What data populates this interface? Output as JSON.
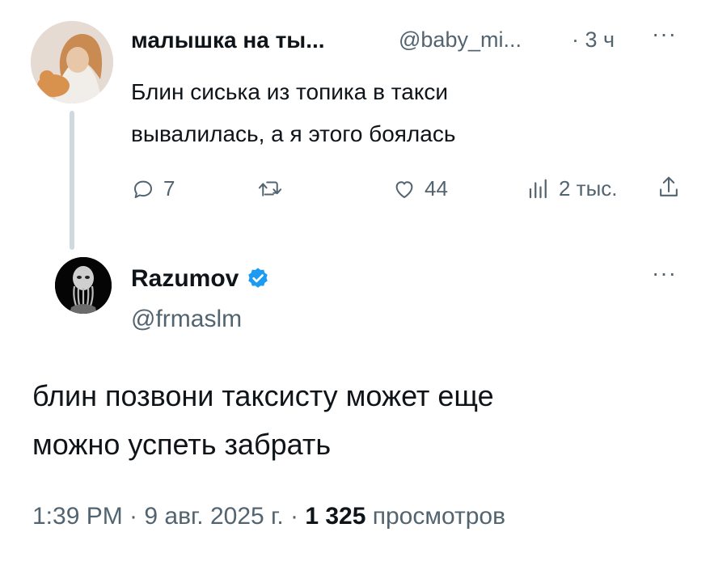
{
  "parent_tweet": {
    "display_name": "малышка на ты...",
    "handle": "@baby_mi...",
    "time": "· 3 ч",
    "more_label": "···",
    "text_line1": "Блин сиська из топика в такси",
    "text_line2": "вывалилась, а я этого боялась",
    "replies": "7",
    "likes": "44",
    "views": "2 тыс."
  },
  "reply_tweet": {
    "display_name": "Razumov",
    "handle": "@frmaslm",
    "more_label": "···",
    "text_line1": "блин позвони таксисту может еще",
    "text_line2": "можно успеть забрать",
    "time_date": "1:39 PM · 9 авг. 2025 г. · ",
    "views_count": "1 325",
    "views_label": " просмотров"
  },
  "colors": {
    "text_primary": "#0f1419",
    "text_secondary": "#536471",
    "thread_line": "#cfd9de",
    "verified_badge": "#1d9bf0"
  },
  "icons": [
    "reply-icon",
    "retweet-icon",
    "like-icon",
    "views-icon",
    "share-icon",
    "verified-badge-icon"
  ]
}
